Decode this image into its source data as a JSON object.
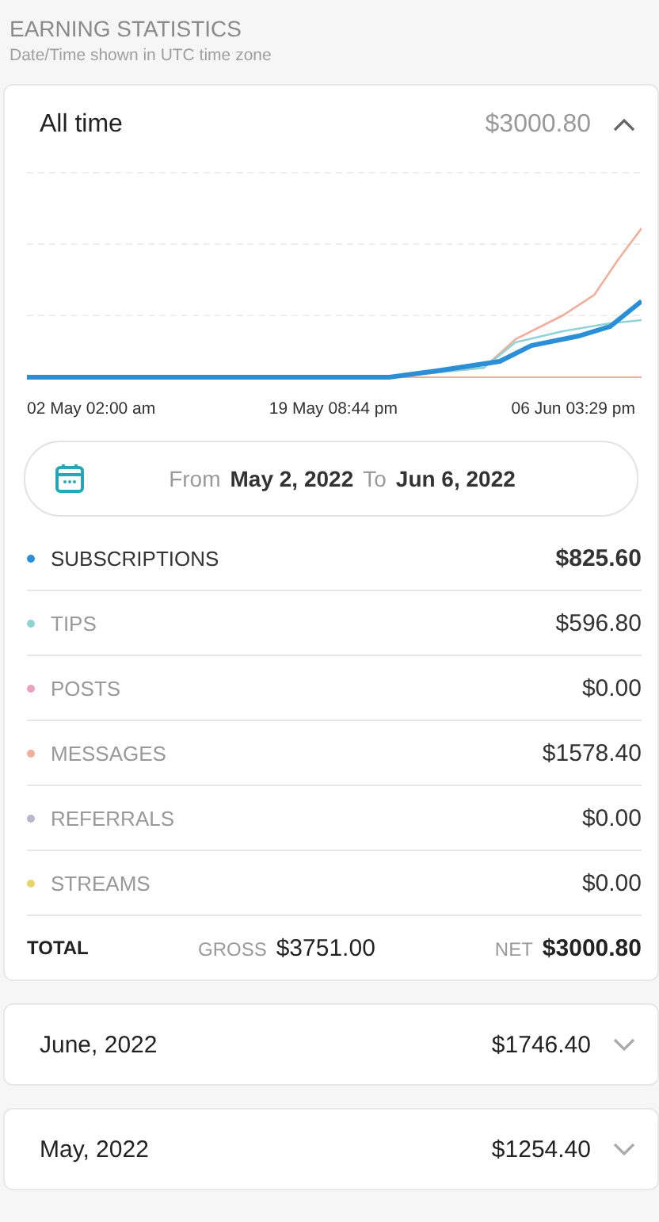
{
  "header": {
    "title": "EARNING STATISTICS",
    "subtitle": "Date/Time shown in UTC time zone"
  },
  "summary": {
    "label": "All time",
    "amount": "$3000.80",
    "expanded": true,
    "chart_axis": [
      "02 May 02:00 am",
      "19 May 08:44 pm",
      "06 Jun 03:29 pm"
    ],
    "range": {
      "from_label": "From",
      "from": "May 2, 2022",
      "to_label": "To",
      "to": "Jun 6, 2022"
    },
    "categories": [
      {
        "name": "SUBSCRIPTIONS",
        "amount": "$825.60",
        "color": "#2a8fd6",
        "selected": true
      },
      {
        "name": "TIPS",
        "amount": "$596.80",
        "color": "#8fd3d6",
        "selected": false
      },
      {
        "name": "POSTS",
        "amount": "$0.00",
        "color": "#e9a3be",
        "selected": false
      },
      {
        "name": "MESSAGES",
        "amount": "$1578.40",
        "color": "#f0ae9c",
        "selected": false
      },
      {
        "name": "REFERRALS",
        "amount": "$0.00",
        "color": "#b9b7cc",
        "selected": false
      },
      {
        "name": "STREAMS",
        "amount": "$0.00",
        "color": "#e8d46a",
        "selected": false
      }
    ],
    "total": {
      "label": "TOTAL",
      "gross_label": "GROSS",
      "gross": "$3751.00",
      "net_label": "NET",
      "net": "$3000.80"
    }
  },
  "periods": [
    {
      "label": "June, 2022",
      "amount": "$1746.40",
      "expanded": false
    },
    {
      "label": "May, 2022",
      "amount": "$1254.40",
      "expanded": false
    }
  ]
}
